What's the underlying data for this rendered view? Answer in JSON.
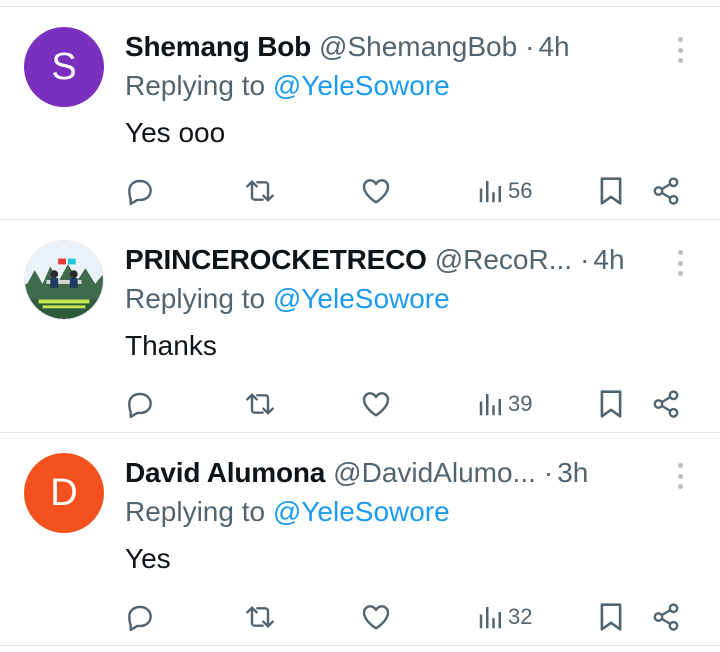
{
  "replies": [
    {
      "name": "Shemang Bob",
      "handle": "@ShemangBob",
      "separator": "·",
      "time": "4h",
      "replying_prefix": "Replying to",
      "replying_to": "@YeleSowore",
      "text": "Yes ooo",
      "views": "56",
      "avatar_letter": "S",
      "avatar_color": "#7b2fbe"
    },
    {
      "name": "PRINCEROCKETRECO",
      "handle": "@RecoR...",
      "separator": "·",
      "time": "4h",
      "replying_prefix": "Replying to",
      "replying_to": "@YeleSowore",
      "text": "Thanks",
      "views": "39",
      "avatar_letter": "",
      "avatar_color": "#6fa3c7"
    },
    {
      "name": "David Alumona",
      "handle": "@DavidAlumo...",
      "separator": "·",
      "time": "3h",
      "replying_prefix": "Replying to",
      "replying_to": "@YeleSowore",
      "text": "Yes",
      "views": "32",
      "avatar_letter": "D",
      "avatar_color": "#f4511e"
    }
  ],
  "colors": {
    "text_primary": "#0f1419",
    "text_secondary": "#536471",
    "mention": "#1d9bf0",
    "divider": "#e6e9ec"
  },
  "icons": [
    "reply-icon",
    "retweet-icon",
    "like-icon",
    "views-icon",
    "bookmark-icon",
    "share-icon",
    "more-options-icon"
  ]
}
